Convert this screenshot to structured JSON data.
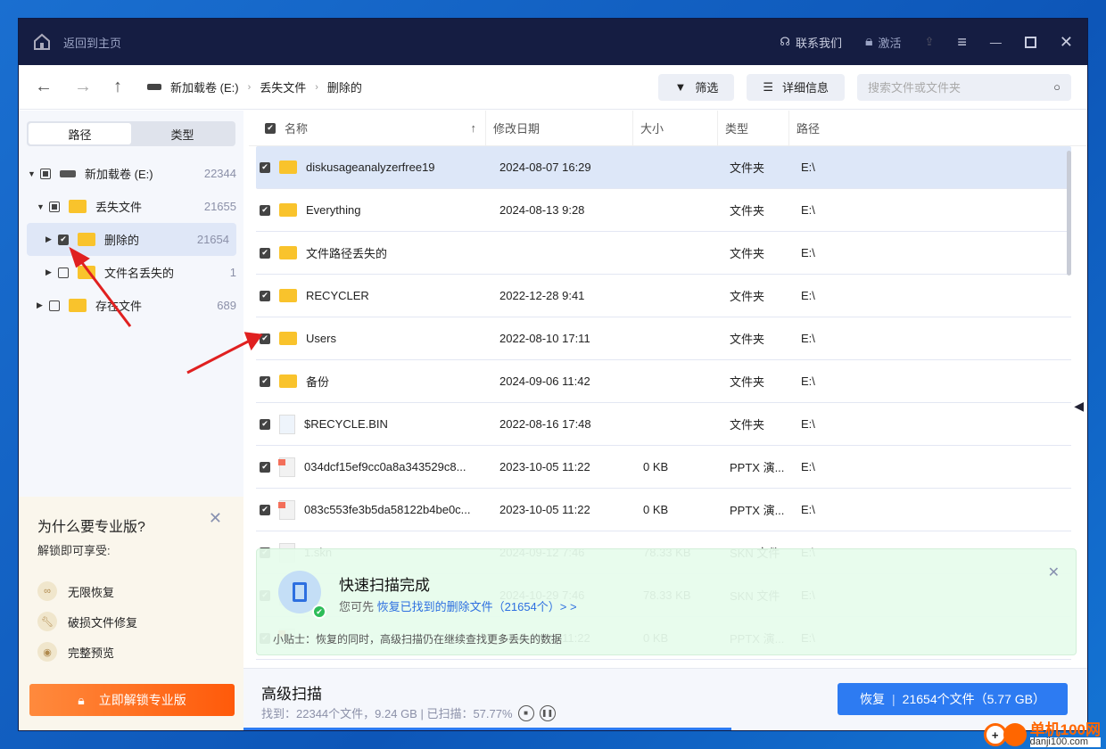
{
  "titlebar": {
    "home_label": "返回到主页",
    "contact": "联系我们",
    "activate": "激活"
  },
  "toolbar": {
    "breadcrumb": [
      "新加载卷 (E:)",
      "丢失文件",
      "删除的"
    ],
    "filter": "筛选",
    "details": "详细信息",
    "search_placeholder": "搜索文件或文件夹"
  },
  "sidebar": {
    "tabs": [
      "路径",
      "类型"
    ],
    "tree": [
      {
        "label": "新加载卷 (E:)",
        "count": "22344"
      },
      {
        "label": "丢失文件",
        "count": "21655"
      },
      {
        "label": "删除的",
        "count": "21654"
      },
      {
        "label": "文件名丢失的",
        "count": "1"
      },
      {
        "label": "存在文件",
        "count": "689"
      }
    ]
  },
  "promo": {
    "title": "为什么要专业版?",
    "subtitle": "解锁即可享受:",
    "features": [
      "无限恢复",
      "破损文件修复",
      "完整预览"
    ],
    "unlock": "立即解锁专业版"
  },
  "table": {
    "headers": [
      "名称",
      "修改日期",
      "大小",
      "类型",
      "路径"
    ],
    "rows": [
      {
        "name": "diskusageanalyzerfree19",
        "date": "2024-08-07 16:29",
        "size": "",
        "type": "文件夹",
        "path": "E:\\",
        "kind": "folder"
      },
      {
        "name": "Everything",
        "date": "2024-08-13 9:28",
        "size": "",
        "type": "文件夹",
        "path": "E:\\",
        "kind": "folder"
      },
      {
        "name": "文件路径丢失的",
        "date": "",
        "size": "",
        "type": "文件夹",
        "path": "E:\\",
        "kind": "folder"
      },
      {
        "name": "RECYCLER",
        "date": "2022-12-28 9:41",
        "size": "",
        "type": "文件夹",
        "path": "E:\\",
        "kind": "folder"
      },
      {
        "name": "Users",
        "date": "2022-08-10 17:11",
        "size": "",
        "type": "文件夹",
        "path": "E:\\",
        "kind": "folder"
      },
      {
        "name": "备份",
        "date": "2024-09-06 11:42",
        "size": "",
        "type": "文件夹",
        "path": "E:\\",
        "kind": "folder"
      },
      {
        "name": "$RECYCLE.BIN",
        "date": "2022-08-16 17:48",
        "size": "",
        "type": "文件夹",
        "path": "E:\\",
        "kind": "bin"
      },
      {
        "name": "034dcf15ef9cc0a8a343529c8...",
        "date": "2023-10-05 11:22",
        "size": "0 KB",
        "type": "PPTX 演...",
        "path": "E:\\",
        "kind": "ppt"
      },
      {
        "name": "083c553fe3b5da58122b4be0c...",
        "date": "2023-10-05 11:22",
        "size": "0 KB",
        "type": "PPTX 演...",
        "path": "E:\\",
        "kind": "ppt"
      },
      {
        "name": "1.skn",
        "date": "2024-09-12 7:46",
        "size": "78.33 KB",
        "type": "SKN 文件",
        "path": "E:\\",
        "kind": "file"
      },
      {
        "name": "",
        "date": "2024-10-29 7:46",
        "size": "78.33 KB",
        "type": "SKN 文件",
        "path": "E:\\",
        "kind": "file"
      },
      {
        "name": "",
        "date": "2023-10-05 11:22",
        "size": "0 KB",
        "type": "PPTX 演...",
        "path": "E:\\",
        "kind": "ppt"
      }
    ]
  },
  "toast": {
    "title": "快速扫描完成",
    "prefix": "您可先",
    "link": "恢复已找到的删除文件（21654个）> >",
    "tip": "小贴士：恢复的同时，高级扫描仍在继续查找更多丢失的数据"
  },
  "bottom": {
    "title": "高级扫描",
    "status": "找到：22344个文件，9.24 GB | 已扫描：57.77%",
    "progress": 57.77,
    "recover": "恢复",
    "recover_detail": "21654个文件（5.77 GB）"
  },
  "watermark": {
    "name": "单机100网",
    "url": "danji100.com"
  },
  "colors": {
    "titlebar": "#151d42",
    "accent": "#2d7bf2",
    "unlock": "#ff6a1a",
    "folder": "#f9c32c"
  }
}
